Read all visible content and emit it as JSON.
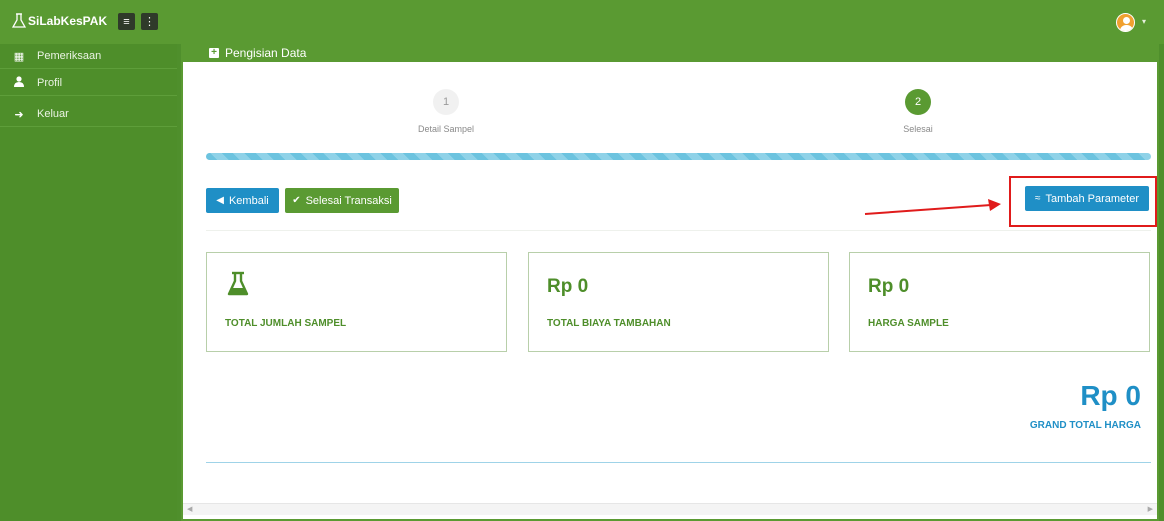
{
  "app": {
    "brand": "SiLabKesPAK"
  },
  "topbar": {
    "menu_icon": "hamburger-icon",
    "more_icon": "vertical-dots-icon",
    "avatar_icon": "user-avatar-icon",
    "caret": "▾"
  },
  "sidebar": {
    "items": [
      {
        "label": "Pemeriksaan",
        "icon": "table-icon",
        "glyph": "▦"
      },
      {
        "label": "Profil",
        "icon": "user-icon",
        "glyph": "👤"
      },
      {
        "label": "Keluar",
        "icon": "sign-out-icon",
        "glyph": "➜"
      }
    ]
  },
  "panel": {
    "title": "Pengisian Data"
  },
  "wizard": {
    "steps": [
      {
        "number": "1",
        "label": "Detail Sampel",
        "state": "inactive"
      },
      {
        "number": "2",
        "label": "Selesai",
        "state": "active"
      }
    ]
  },
  "actions": {
    "back_label": "Kembali",
    "finish_label": "Selesai Transaksi",
    "add_param_label": "Tambah Parameter"
  },
  "cards": [
    {
      "value": "",
      "caption": "TOTAL JUMLAH SAMPEL",
      "icon": "flask-icon"
    },
    {
      "value": "Rp  0",
      "caption": "TOTAL BIAYA TAMBAHAN"
    },
    {
      "value": "Rp  0",
      "caption": "HARGA SAMPLE"
    }
  ],
  "grand_total": {
    "value": "Rp  0",
    "caption": "GRAND TOTAL HARGA"
  },
  "colors": {
    "primary_green": "#5a9a32",
    "accent_blue": "#1f8fc6",
    "highlight_red": "#e01b1b"
  }
}
